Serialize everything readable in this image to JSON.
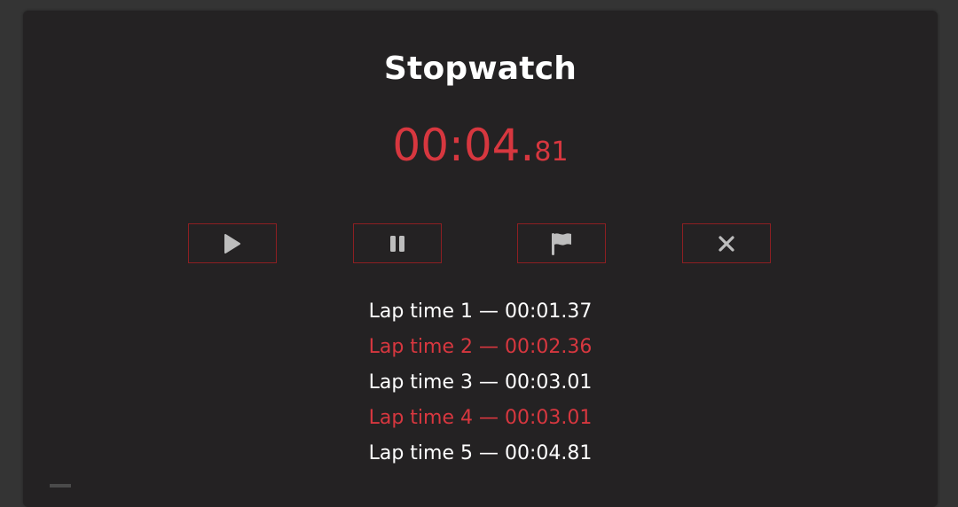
{
  "app": {
    "title": "Stopwatch"
  },
  "timer": {
    "main": "00:04.",
    "fraction": "81",
    "color": "#d7373f"
  },
  "controls": [
    {
      "icon": "play-icon",
      "label": "Start"
    },
    {
      "icon": "pause-icon",
      "label": "Pause"
    },
    {
      "icon": "flag-icon",
      "label": "Lap"
    },
    {
      "icon": "close-icon",
      "label": "Reset"
    }
  ],
  "laps": [
    {
      "text": "Lap time 1 — 00:01.37",
      "color": "#ffffff"
    },
    {
      "text": "Lap time 2 — 00:02.36",
      "color": "#d7373f"
    },
    {
      "text": "Lap time 3 — 00:03.01",
      "color": "#ffffff"
    },
    {
      "text": "Lap time 4 — 00:03.01",
      "color": "#d7373f"
    },
    {
      "text": "Lap time 5 — 00:04.81",
      "color": "#ffffff"
    }
  ],
  "theme": {
    "background": "#343434",
    "card": "#242223",
    "accent": "#d7373f",
    "button_border": "#8d1f22",
    "icon": "#bdbdbd"
  }
}
